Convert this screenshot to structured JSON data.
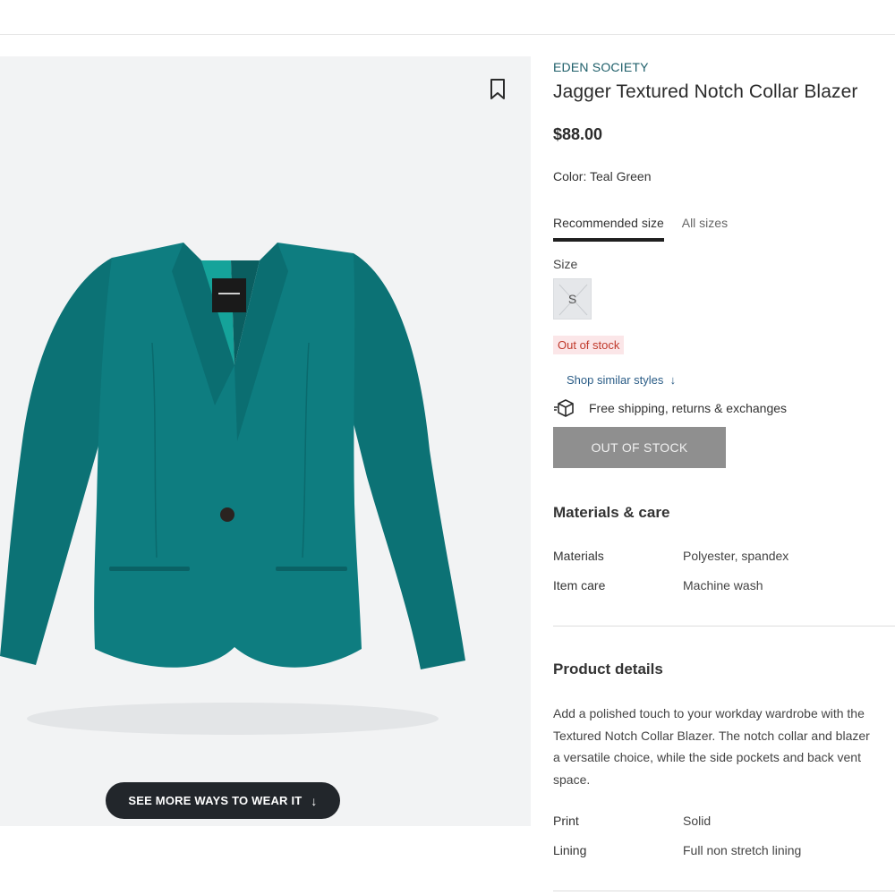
{
  "product": {
    "brand": "EDEN SOCIETY",
    "title": "Jagger Textured Notch Collar Blazer",
    "price": "$88.00",
    "color_label": "Color:",
    "color_value": "Teal Green",
    "image_color": "#0e7d80"
  },
  "size_tabs": [
    "Recommended size",
    "All sizes"
  ],
  "size": {
    "label": "Size",
    "options": [
      "S"
    ],
    "status": "Out of stock"
  },
  "links": {
    "shop_similar": "Shop similar styles",
    "shop_similar_icon": "arrow-down-icon"
  },
  "shipping": {
    "icon": "box-return-icon",
    "text": "Free shipping, returns & exchanges"
  },
  "buttons": {
    "out_of_stock": "OUT OF STOCK",
    "see_more": "SEE MORE WAYS TO WEAR IT",
    "see_more_icon": "arrow-down-icon",
    "bookmark_icon": "bookmark-icon"
  },
  "materials": {
    "title": "Materials & care",
    "rows": [
      {
        "label": "Materials",
        "value": "Polyester, spandex"
      },
      {
        "label": "Item care",
        "value": "Machine wash"
      }
    ]
  },
  "details": {
    "title": "Product details",
    "description_lines": [
      "Add a polished touch to your workday wardrobe with the",
      "Textured Notch Collar Blazer. The notch collar and blazer",
      "a versatile choice, while the side pockets and back vent",
      "space."
    ],
    "rows": [
      {
        "label": "Print",
        "value": "Solid"
      },
      {
        "label": "Lining",
        "value": "Full non stretch lining"
      }
    ]
  },
  "colors": {
    "brand_teal": "#1d5e69",
    "oos_button": "#8f8f8f",
    "oos_badge_bg": "#fbe6e8",
    "oos_badge_text": "#c0392b",
    "dark_pill": "#22262b"
  }
}
